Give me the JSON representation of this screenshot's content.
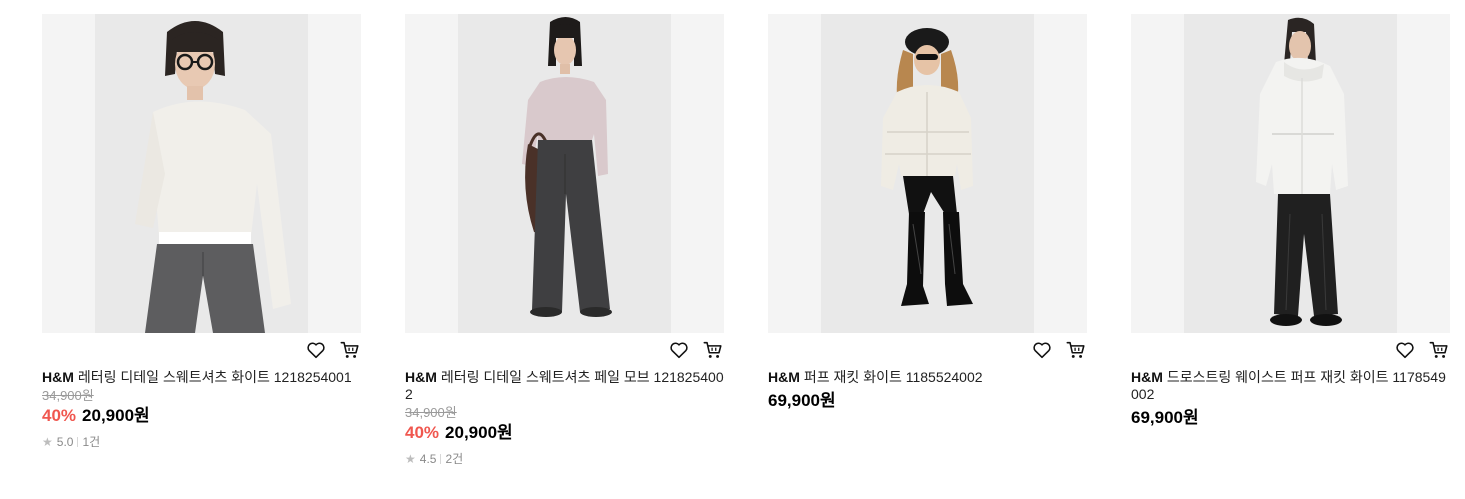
{
  "products": [
    {
      "brand": "H&M",
      "name": "레터링 디테일 스웨트셔츠 화이트 121825400​1",
      "original_price": "34,900원",
      "discount": "40%",
      "price": "20,900원",
      "rating": "5.0",
      "reviews": "1건",
      "icons": [
        "heart-icon",
        "cart-icon"
      ]
    },
    {
      "brand": "H&M",
      "name": "레터링 디테일 스웨트셔츠 페일 모브 1218254​002",
      "original_price": "34,900원",
      "discount": "40%",
      "price": "20,900원",
      "rating": "4.5",
      "reviews": "2건",
      "icons": [
        "heart-icon",
        "cart-icon"
      ]
    },
    {
      "brand": "H&M",
      "name": "퍼프 재킷 화이트 1185524002",
      "price": "69,900원",
      "icons": [
        "heart-icon",
        "cart-icon"
      ]
    },
    {
      "brand": "H&M",
      "name": "드로스트링 웨이스트 퍼프 재킷 화이트 11785​49002",
      "price": "69,900원",
      "icons": [
        "heart-icon",
        "cart-icon"
      ]
    }
  ],
  "colors": {
    "discount": "#f0574f",
    "strikethrough": "#9a9a9a",
    "image_bg": "#f4f4f4"
  }
}
